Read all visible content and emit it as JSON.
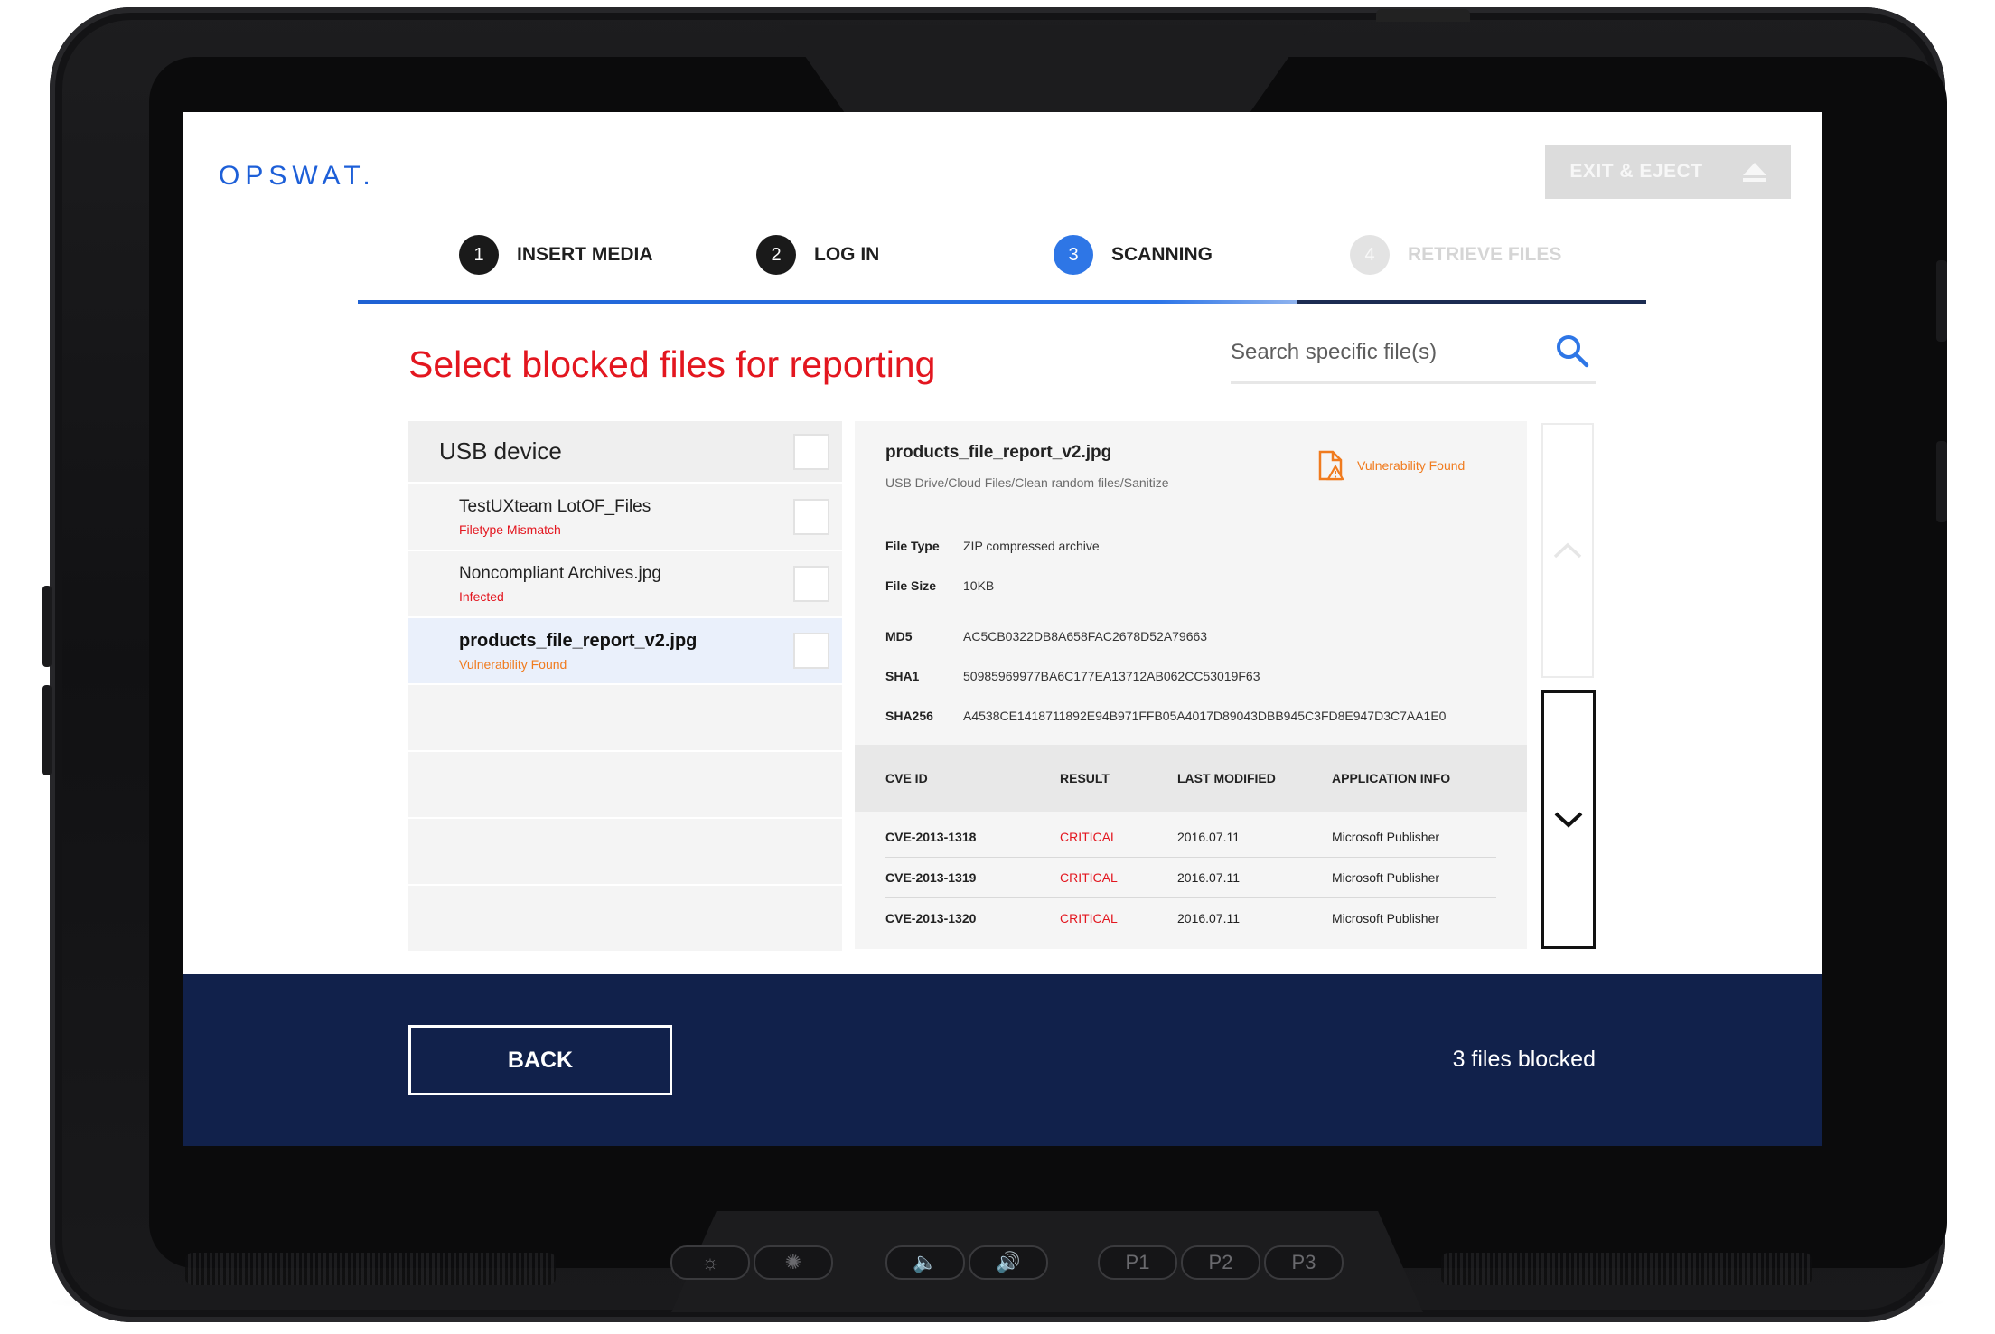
{
  "app": {
    "logo": "OPSWAT."
  },
  "header": {
    "exit_label": "EXIT & EJECT"
  },
  "stepper": {
    "steps": [
      {
        "num": "1",
        "label": "INSERT MEDIA",
        "state": "done"
      },
      {
        "num": "2",
        "label": "LOG IN",
        "state": "done"
      },
      {
        "num": "3",
        "label": "SCANNING",
        "state": "active"
      },
      {
        "num": "4",
        "label": "RETRIEVE FILES",
        "state": "pending"
      }
    ]
  },
  "main": {
    "title": "Select blocked files for reporting",
    "search_placeholder": "Search specific file(s)"
  },
  "file_list": {
    "group_label": "USB device",
    "items": [
      {
        "name": "TestUXteam LotOF_Files",
        "status": "Filetype Mismatch",
        "status_color": "#e3161f"
      },
      {
        "name": "Noncompliant Archives.jpg",
        "status": "Infected",
        "status_color": "#e3161f"
      },
      {
        "name": "products_file_report_v2.jpg",
        "status": "Vulnerability Found",
        "status_color": "#f07b1e",
        "selected": true
      }
    ]
  },
  "details": {
    "name": "products_file_report_v2.jpg",
    "path": "USB Drive/Cloud Files/Clean random files/Sanitize",
    "badge_label": "Vulnerability Found",
    "badge_icon": "file-warning-icon",
    "file_type_label": "File Type",
    "file_type": "ZIP compressed archive",
    "file_size_label": "File Size",
    "file_size": "10KB",
    "md5_label": "MD5",
    "md5": "AC5CB0322DB8A658FAC2678D52A79663",
    "sha1_label": "SHA1",
    "sha1": "50985969977BA6C177EA13712AB062CC53019F63",
    "sha256_label": "SHA256",
    "sha256": "A4538CE1418711892E94B971FFB05A4017D89043DBB945C3FD8E947D3C7AA1E0"
  },
  "cve_table": {
    "headers": [
      "CVE ID",
      "RESULT",
      "LAST MODIFIED",
      "APPLICATION INFO"
    ],
    "rows": [
      {
        "id": "CVE-2013-1318",
        "result": "CRITICAL",
        "modified": "2016.07.11",
        "app": "Microsoft Publisher"
      },
      {
        "id": "CVE-2013-1319",
        "result": "CRITICAL",
        "modified": "2016.07.11",
        "app": "Microsoft Publisher"
      },
      {
        "id": "CVE-2013-1320",
        "result": "CRITICAL",
        "modified": "2016.07.11",
        "app": "Microsoft Publisher"
      }
    ]
  },
  "footer": {
    "back_label": "BACK",
    "blocked_count": "3 files blocked"
  },
  "hardware": {
    "p_buttons": [
      "P1",
      "P2",
      "P3"
    ]
  },
  "colors": {
    "accent_blue": "#2e76e6",
    "brand_blue": "#1d5fd8",
    "title_red": "#e3161f",
    "warning_orange": "#f07b1e",
    "footer_navy": "#11214b"
  }
}
